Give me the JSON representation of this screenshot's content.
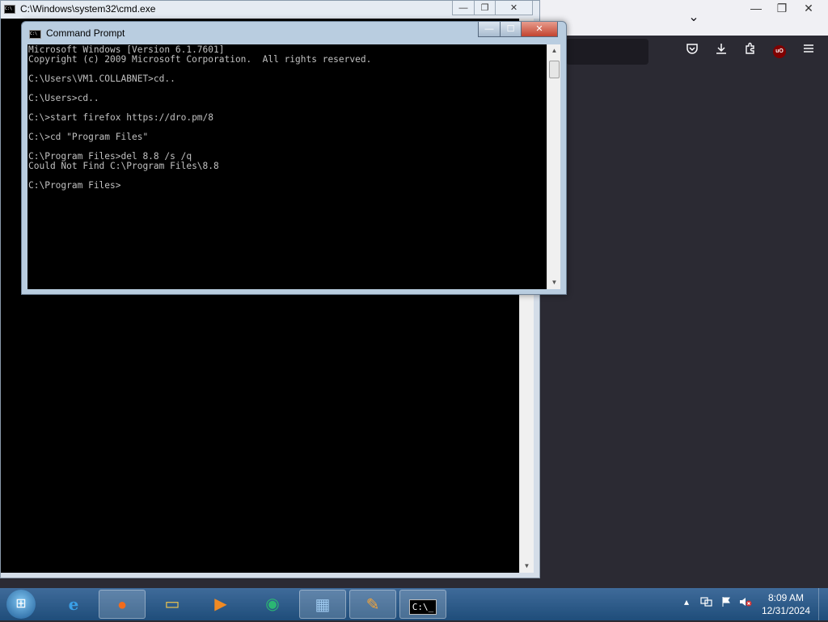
{
  "firefox": {
    "tabs_chevron": "⌄",
    "caption": {
      "minimize": "—",
      "restore": "❐",
      "close": "✕"
    },
    "toolbar": {
      "pocket_icon": "pocket-icon",
      "download_icon": "download-icon",
      "extensions_icon": "puzzle-icon",
      "ublock_label": "uO",
      "menu_icon": "hamburger-menu-icon"
    }
  },
  "cmd_back": {
    "title": "C:\\Windows\\system32\\cmd.exe",
    "icon_text": "C:\\",
    "caption": {
      "minimize": "—",
      "restore": "❐",
      "close": "✕"
    }
  },
  "cmd_front": {
    "title": "Command Prompt",
    "icon_text": "C:\\",
    "caption": {
      "minimize": "—",
      "maximize": "☐",
      "close": "✕"
    },
    "console_text": "Microsoft Windows [Version 6.1.7601]\nCopyright (c) 2009 Microsoft Corporation.  All rights reserved.\n\nC:\\Users\\VM1.COLLABNET>cd..\n\nC:\\Users>cd..\n\nC:\\>start firefox https://dro.pm/8\n\nC:\\>cd \"Program Files\"\n\nC:\\Program Files>del 8.8 /s /q\nCould Not Find C:\\Program Files\\8.8\n\nC:\\Program Files>"
  },
  "taskbar": {
    "start_glyph": "⊞",
    "items": [
      {
        "name": "internet-explorer",
        "glyph": "e",
        "color": "#3aa0e8"
      },
      {
        "name": "firefox",
        "glyph": "●",
        "color": "#f36c1c"
      },
      {
        "name": "file-explorer",
        "glyph": "▭",
        "color": "#f4c84d"
      },
      {
        "name": "media-player",
        "glyph": "▶",
        "color": "#f08a24"
      },
      {
        "name": "app-green",
        "glyph": "◉",
        "color": "#2bb673"
      },
      {
        "name": "control-panel",
        "glyph": "▦",
        "color": "#9ec9ef"
      },
      {
        "name": "paint",
        "glyph": "✎",
        "color": "#f2a33a"
      },
      {
        "name": "cmd",
        "glyph": "C:\\_",
        "color": "#ffffff"
      }
    ],
    "tray": {
      "chevron": "▴",
      "time": "8:09 AM",
      "date": "12/31/2024"
    }
  }
}
